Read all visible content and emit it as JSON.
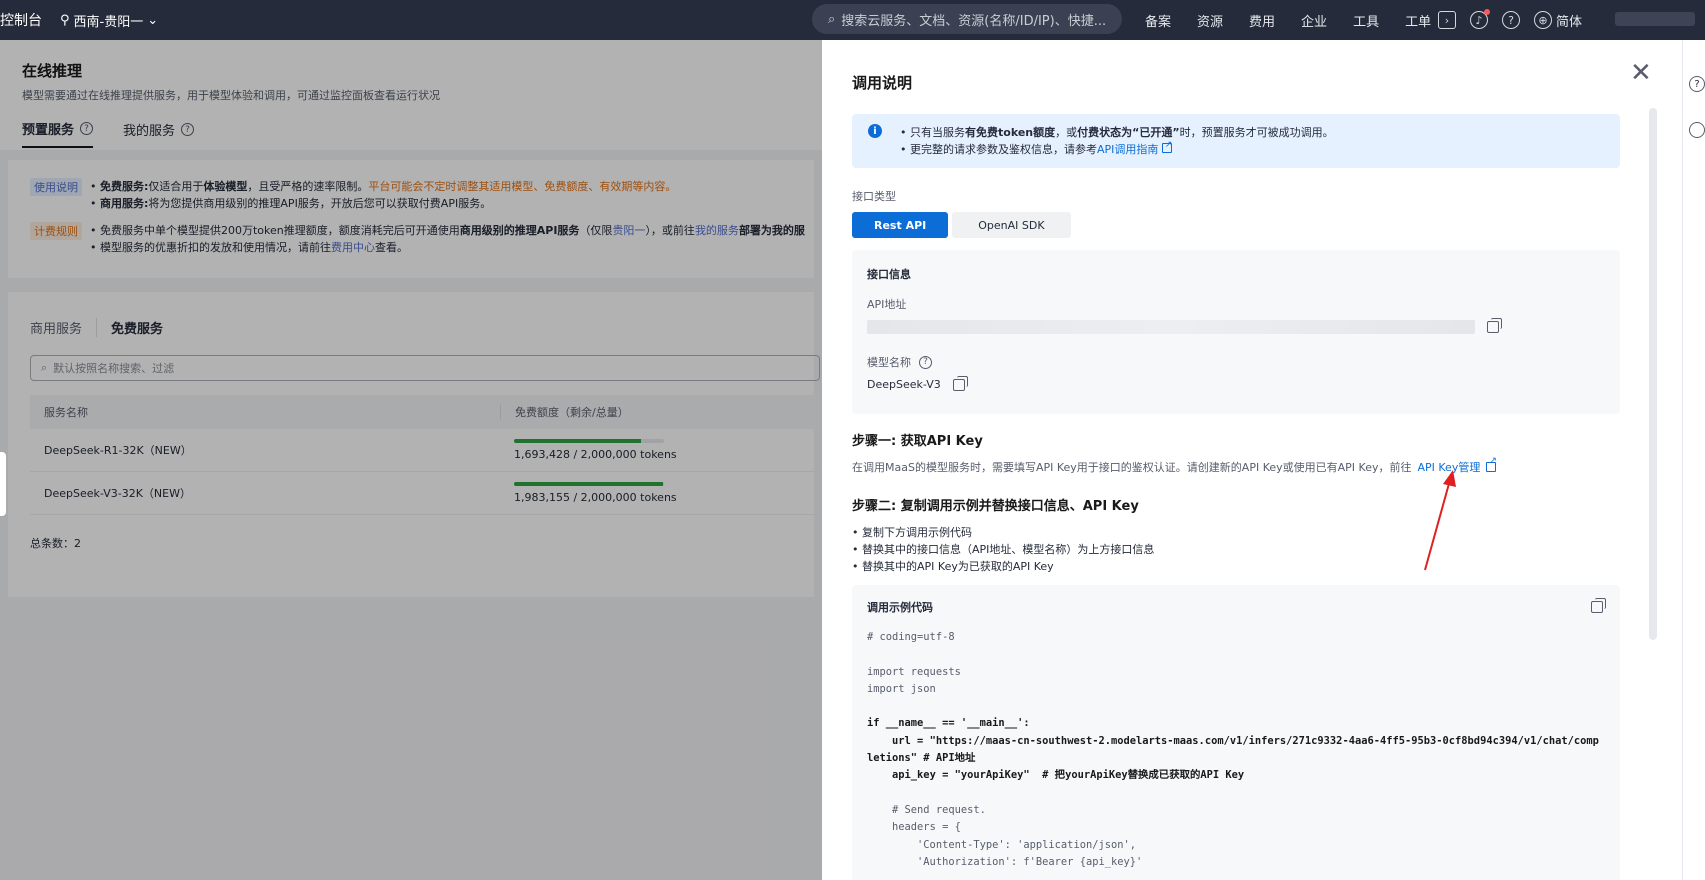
{
  "topbar": {
    "brand": "控制台",
    "region": "西南-贵阳一",
    "search_placeholder": "搜索云服务、文档、资源(名称/ID/IP)、快捷...",
    "nav": [
      "备案",
      "资源",
      "费用",
      "企业",
      "工具",
      "工单"
    ],
    "lang": "简体",
    "icons": [
      "terminal-icon",
      "bell-icon",
      "help-icon",
      "globe-icon"
    ]
  },
  "page": {
    "title": "在线推理",
    "subtitle": "模型需要通过在线推理提供服务，用于模型体验和调用，可通过监控面板查看运行状况",
    "tabs": [
      "预置服务",
      "我的服务"
    ],
    "notice": {
      "usage_tag": "使用说明",
      "usage_1_bold": "免费服务:",
      "usage_1_a": "仅适合用于",
      "usage_1_b": "体验模型",
      "usage_1_c": "，且受严格的速率限制。",
      "usage_1_warn": "平台可能会不定时调整其适用模型、免费额度、有效期等内容。",
      "usage_2_bold": "商用服务:",
      "usage_2_text": "将为您提供商用级别的推理API服务，开放后您可以获取付费API服务。",
      "billing_tag": "计费规则",
      "billing_1_a": "免费服务中单个模型提供200万token推理额度，额度消耗完后可开通使用",
      "billing_1_b": "商用级别的推理API服务",
      "billing_1_c": "（仅限",
      "billing_1_link1": "贵阳一",
      "billing_1_d": "），或前往",
      "billing_1_link2": "我的服务",
      "billing_1_e": "部署为我的服",
      "billing_2_a": "模型服务的优惠折扣的发放和使用情况，请前往",
      "billing_2_link": "费用中心",
      "billing_2_b": "查看。"
    },
    "service_tabs": [
      "商用服务",
      "免费服务"
    ],
    "search_placeholder": "默认按照名称搜索、过滤",
    "table": {
      "headers": [
        "服务名称",
        "免费额度（剩余/总量）"
      ],
      "rows": [
        {
          "name": "DeepSeek-R1-32K（NEW）",
          "quota": "1,693,428 / 2,000,000 tokens",
          "ratio": 0.8467
        },
        {
          "name": "DeepSeek-V3-32K（NEW）",
          "quota": "1,983,155 / 2,000,000 tokens",
          "ratio": 0.9916
        }
      ]
    },
    "total": "总条数：2"
  },
  "drawer": {
    "title": "调用说明",
    "info_1_a": "只有当服务",
    "info_1_b": "有免费token额度",
    "info_1_c": "，或",
    "info_1_d": "付费状态为“已开通”",
    "info_1_e": "时，预置服务才可被成功调用。",
    "info_2_a": "更完整的请求参数及鉴权信息，请参考",
    "info_2_link": "API调用指南",
    "api_type_label": "接口类型",
    "api_types": [
      "Rest API",
      "OpenAI SDK"
    ],
    "endpoint_title": "接口信息",
    "api_addr_label": "API地址",
    "model_name_label": "模型名称",
    "model_name": "DeepSeek-V3",
    "step1_title": "步骤一: 获取API Key",
    "step1_desc": "在调用MaaS的模型服务时，需要填写API Key用于接口的鉴权认证。请创建新的API Key或使用已有API Key，前往",
    "step1_link": "API Key管理",
    "step2_title": "步骤二: 复制调用示例并替换接口信息、API Key",
    "step2_items": [
      "复制下方调用示例代码",
      "替换其中的接口信息（API地址、模型名称）为上方接口信息",
      "替换其中的API Key为已获取的API Key"
    ],
    "code_title": "调用示例代码",
    "code_lines": [
      "# coding=utf-8",
      "",
      "import requests",
      "import json",
      "",
      "if __name__ == '__main__':",
      "    url = \"https://maas-cn-southwest-2.modelarts-maas.com/v1/infers/271c9332-4aa6-4ff5-95b3-0cf8bd94c394/v1/chat/completions\" # API地址",
      "    api_key = \"yourApiKey\"  # 把yourApiKey替换成已获取的API Key",
      "",
      "    # Send request.",
      "    headers = {",
      "        'Content-Type': 'application/json',",
      "        'Authorization': f'Bearer {api_key}'"
    ]
  },
  "colors": {
    "primary": "#0d6dd6",
    "topbar": "#252b3a",
    "progress": "#2da544",
    "annotation_arrow": "#e02020"
  }
}
